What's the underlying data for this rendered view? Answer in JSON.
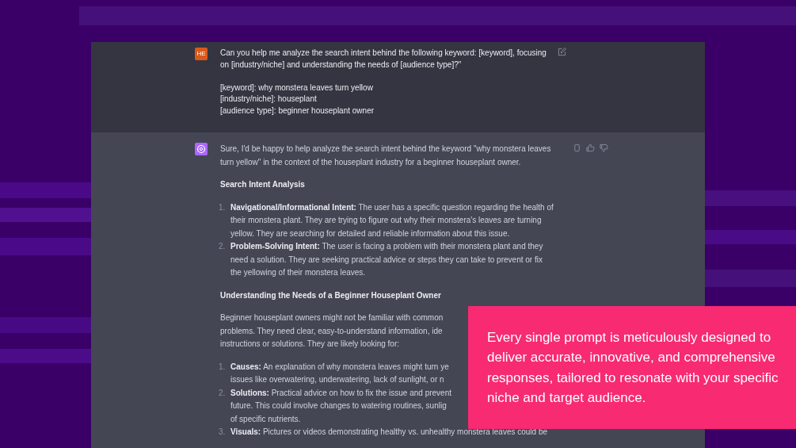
{
  "prompt": {
    "avatar": "HE",
    "paragraphs": [
      [
        "Can you help me analyze the search intent behind the following keyword: [keyword], focusing",
        "on [industry/niche] and understanding the needs of [audience type]?\""
      ],
      [
        "[keyword]: why monstera leaves turn yellow",
        "[industry/niche]: houseplant",
        "[audience type]: beginner houseplant owner"
      ]
    ]
  },
  "response": {
    "blocks": [
      {
        "kind": "paragraph",
        "lines": [
          "Sure, I'd be happy to help analyze the search intent behind the keyword \"why monstera leaves",
          "turn yellow\" in the context of the houseplant industry for a beginner houseplant owner."
        ]
      },
      {
        "kind": "heading",
        "text": "Search Intent Analysis"
      },
      {
        "kind": "list",
        "items": [
          {
            "number": "1.",
            "lines": [
              "**Navigational/Informational Intent:** The user has a specific question regarding the health of",
              "their monstera plant. They are trying to figure out why their monstera's leaves are turning",
              "yellow. They are searching for detailed and reliable information about this issue."
            ]
          },
          {
            "number": "2.",
            "lines": [
              "**Problem-Solving Intent:** The user is facing a problem with their monstera plant and they",
              "need a solution. They are seeking practical advice or steps they can take to prevent or fix",
              "the yellowing of their monstera leaves."
            ]
          }
        ]
      },
      {
        "kind": "heading",
        "text": "Understanding the Needs of a Beginner Houseplant Owner"
      },
      {
        "kind": "paragraph",
        "lines": [
          "Beginner houseplant owners might not be familiar with common",
          "problems. They need clear, easy-to-understand information, ide",
          "instructions or solutions. They are likely looking for:"
        ]
      },
      {
        "kind": "list",
        "items": [
          {
            "number": "1.",
            "lines": [
              "**Causes:** An explanation of why monstera leaves might turn ye",
              "issues like overwatering, underwatering, lack of sunlight, or n"
            ]
          },
          {
            "number": "2.",
            "lines": [
              "**Solutions:** Practical advice on how to fix the issue and prevent",
              "future. This could involve changes to watering routines, sunlig",
              "of specific nutrients."
            ]
          },
          {
            "number": "3.",
            "lines": [
              "**Visuals:** Pictures or videos demonstrating healthy vs. unhealthy monstera leaves could be"
            ]
          }
        ]
      }
    ]
  },
  "callout": {
    "text": "Every single prompt is meticulously designed to deliver accurate, innovative, and comprehensive responses, tailored to resonate with your specific niche and target audience."
  }
}
